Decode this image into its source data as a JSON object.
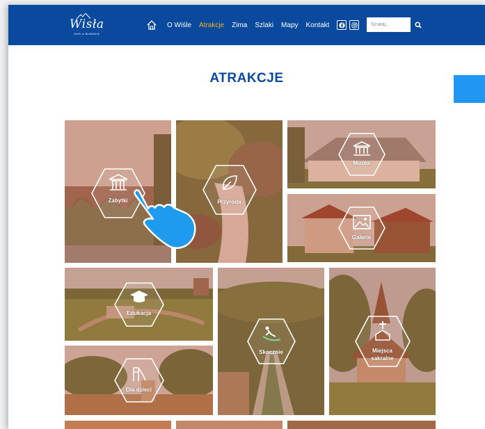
{
  "brand": {
    "logo_text": "Wisła",
    "tagline": "Perła w Beskidach"
  },
  "nav": {
    "items": [
      {
        "label": "O Wiśle",
        "active": false
      },
      {
        "label": "Atrakcje",
        "active": true
      },
      {
        "label": "Zima",
        "active": false
      },
      {
        "label": "Szlaki",
        "active": false
      },
      {
        "label": "Mapy",
        "active": false
      },
      {
        "label": "Kontakt",
        "active": false
      }
    ],
    "search_placeholder": "Szukaj...",
    "icons": [
      "home-icon",
      "facebook-icon",
      "instagram-icon",
      "search-icon"
    ]
  },
  "page": {
    "title": "ATRAKCJE"
  },
  "tiles": [
    {
      "label": "Zabytki",
      "icon": "monument-icon"
    },
    {
      "label": "Przyroda",
      "icon": "leaf-icon"
    },
    {
      "label": "Muzea",
      "icon": "museum-icon"
    },
    {
      "label": "Galerie",
      "icon": "gallery-icon"
    },
    {
      "label": "Edukacja",
      "icon": "graduation-cap-icon"
    },
    {
      "label": "Skocznie",
      "icon": "ski-jumper-icon"
    },
    {
      "label": "Miejsca",
      "label2": "sakralne",
      "icon": "cross-church-icon"
    },
    {
      "label": "Dla dzieci",
      "icon": "playground-slide-icon"
    }
  ],
  "colors": {
    "nav_bg": "#0a4a9e",
    "accent": "#f3b21b",
    "title": "#0a4a9e",
    "side_tab": "#2196f3",
    "tile_tint": "#be5f3c",
    "hand_cursor": "#1e9bef"
  }
}
